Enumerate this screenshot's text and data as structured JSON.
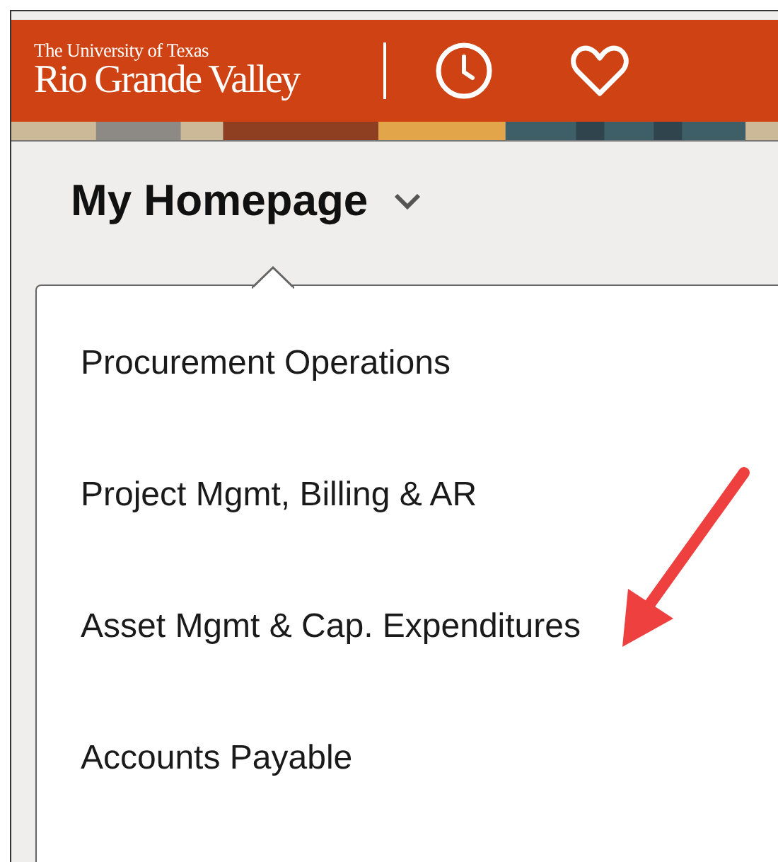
{
  "header": {
    "logo": {
      "line_1": "The University of Texas",
      "line_2": "Rio Grande Valley"
    }
  },
  "page_title": {
    "text": "My Homepage",
    "expanded": true
  },
  "menu": {
    "items": [
      {
        "label": "Procurement Operations",
        "selected": false
      },
      {
        "label": "Project Mgmt, Billing & AR",
        "selected": false
      },
      {
        "label": "Asset Mgmt & Cap. Expenditures",
        "selected": false
      },
      {
        "label": "Accounts Payable",
        "selected": false
      }
    ]
  }
}
